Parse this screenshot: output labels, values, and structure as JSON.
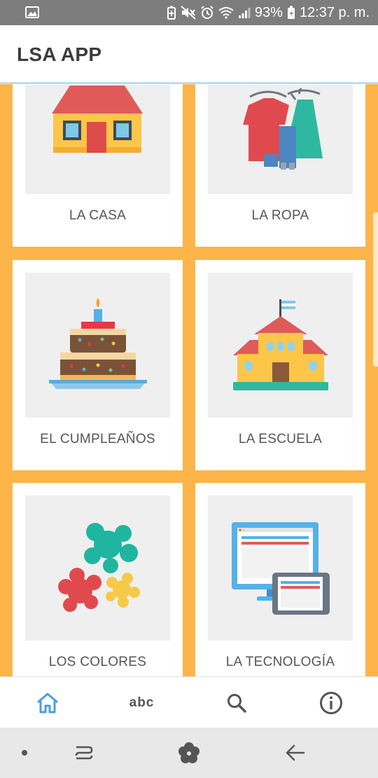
{
  "status_bar": {
    "battery": "93%",
    "time": "12:37 p. m.",
    "icons": [
      "image-icon",
      "battery-saver-icon",
      "mute-icon",
      "alarm-icon",
      "wifi-icon",
      "signal-icon",
      "battery-charging-icon"
    ]
  },
  "app_bar": {
    "title": "LSA APP"
  },
  "categories": [
    {
      "label": "LA CASA",
      "icon": "house-icon"
    },
    {
      "label": "LA ROPA",
      "icon": "clothes-icon"
    },
    {
      "label": "EL CUMPLEAÑOS",
      "icon": "birthday-cake-icon"
    },
    {
      "label": "LA ESCUELA",
      "icon": "school-icon"
    },
    {
      "label": "LOS COLORES",
      "icon": "paint-splash-icon"
    },
    {
      "label": "LA TECNOLOGÍA",
      "icon": "computer-tablet-icon"
    }
  ],
  "bottom_nav": {
    "items": [
      {
        "name": "home",
        "icon": "home-icon",
        "active": true
      },
      {
        "name": "abc",
        "label": "abc"
      },
      {
        "name": "search",
        "icon": "search-icon"
      },
      {
        "name": "info",
        "icon": "info-icon"
      }
    ],
    "active_color": "#4a9fd8",
    "inactive_color": "#555555"
  },
  "colors": {
    "background": "#fdb54a",
    "card": "#ffffff",
    "thumb": "#efefef"
  }
}
